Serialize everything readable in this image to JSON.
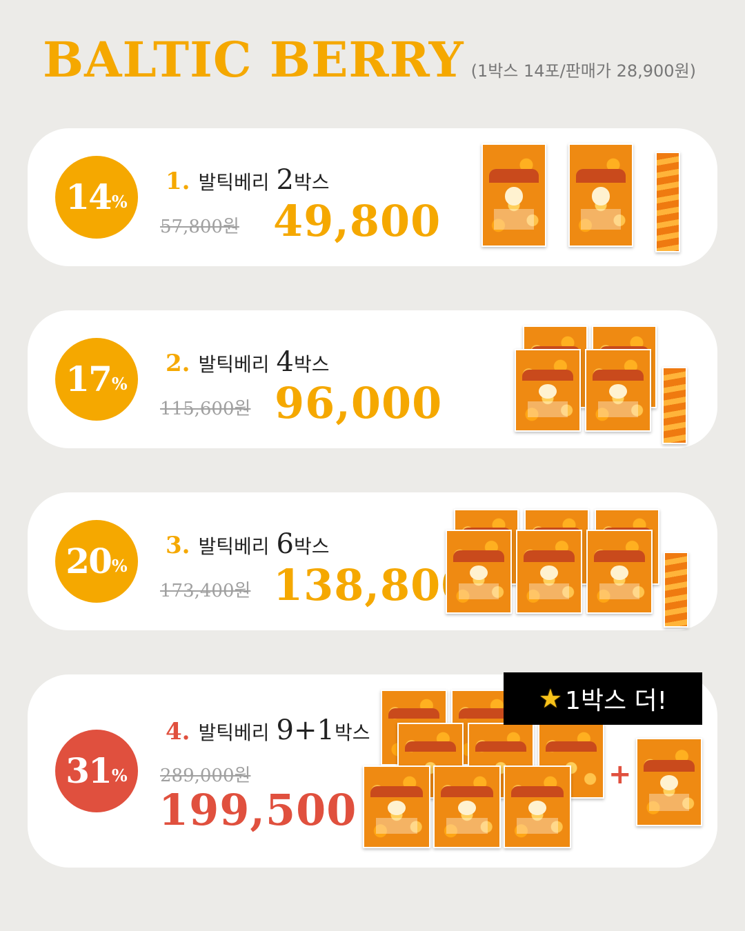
{
  "header": {
    "brand": "BALTIC BERRY",
    "subtitle": "(1박스 14포/판매가 28,900원)"
  },
  "colors": {
    "yellow": "#f5a800",
    "red": "#e0503e",
    "card": "#ffffff",
    "background": "#ecebe8"
  },
  "offers": [
    {
      "discount": "14",
      "percent_sign": "%",
      "index": "1.",
      "name": "발틱베리",
      "qty": "2",
      "unit": "박스",
      "original_price": "57,800원",
      "price": "49,800",
      "color": "#f5a800"
    },
    {
      "discount": "17",
      "percent_sign": "%",
      "index": "2.",
      "name": "발틱베리",
      "qty": "4",
      "unit": "박스",
      "original_price": "115,600원",
      "price": "96,000",
      "color": "#f5a800"
    },
    {
      "discount": "20",
      "percent_sign": "%",
      "index": "3.",
      "name": "발틱베리",
      "qty": "6",
      "unit": "박스",
      "original_price": "173,400원",
      "price": "138,800",
      "color": "#f5a800"
    },
    {
      "discount": "31",
      "percent_sign": "%",
      "index": "4.",
      "name": "발틱베리",
      "qty": "9+1",
      "unit": "박스",
      "original_price": "289,000원",
      "price": "199,500",
      "color": "#e0503e"
    }
  ],
  "bonus": {
    "icon": "star-icon",
    "label": "1박스 더!",
    "plus": "+"
  }
}
